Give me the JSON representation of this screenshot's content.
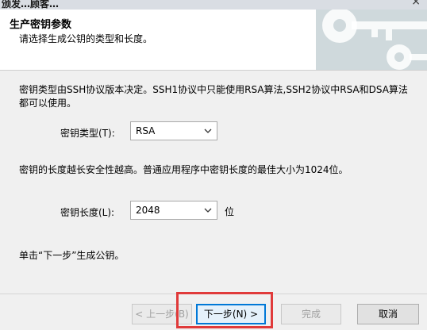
{
  "titlebar": {
    "title_fragment": "颁发…顾客…",
    "close_glyph": "×"
  },
  "header": {
    "title": "生产密钥参数",
    "subtitle": "请选择生成公钥的类型和长度。",
    "art_icon": "key-graphic"
  },
  "body": {
    "intro": "密钥类型由SSH协议版本决定。SSH1协议中只能使用RSA算法,SSH2协议中RSA和DSA算法都可以使用。",
    "key_type_label": "密钥类型(T):",
    "key_type_value": "RSA",
    "length_note": "密钥的长度越长安全性越高。普通应用程序中密钥长度的最佳大小为1024位。",
    "key_length_label": "密钥长度(L):",
    "key_length_value": "2048",
    "key_length_unit": "位",
    "next_hint": "单击“下一步”生成公钥。"
  },
  "buttons": {
    "back": "< 上一步(B)",
    "next": "下一步(N) >",
    "finish": "完成",
    "cancel": "取消"
  },
  "colors": {
    "highlight": "#e03a3a",
    "focus": "#0078d7"
  }
}
